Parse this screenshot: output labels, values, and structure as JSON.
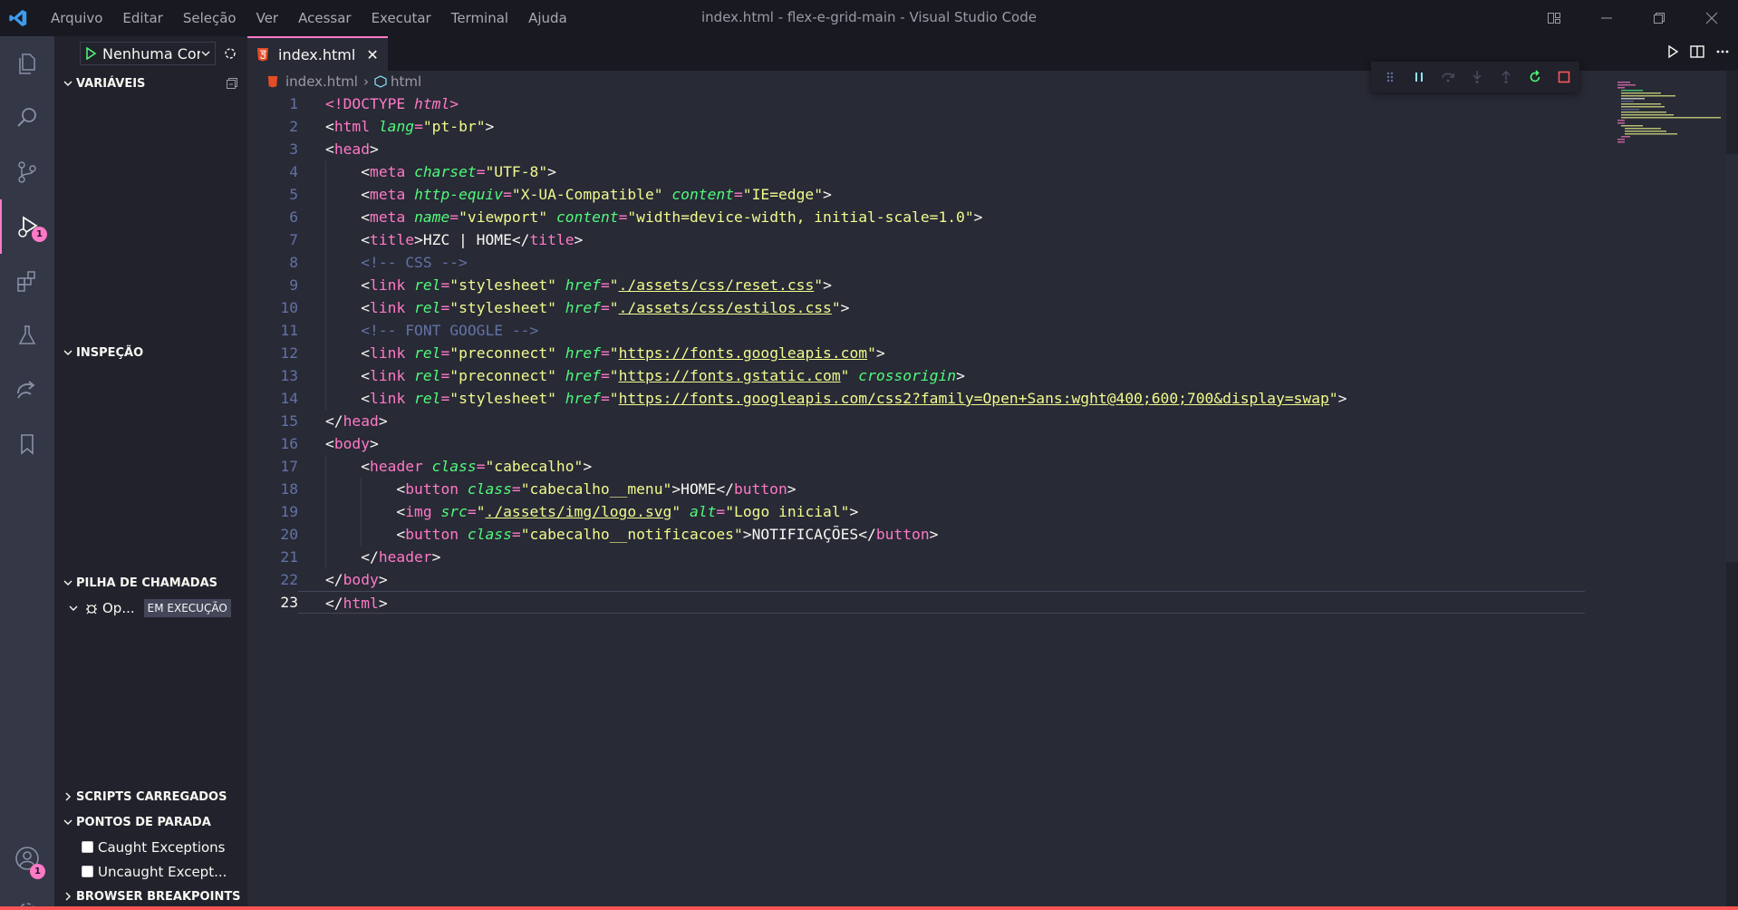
{
  "titlebar": {
    "menu": [
      "Arquivo",
      "Editar",
      "Seleção",
      "Ver",
      "Acessar",
      "Executar",
      "Terminal",
      "Ajuda"
    ],
    "window_title": "index.html - flex-e-grid-main - Visual Studio Code"
  },
  "activitybar": {
    "debug_badge": "1",
    "accounts_badge": "1"
  },
  "sidebar": {
    "run_config": "Nenhuma Cor",
    "variables_title": "VARIÁVEIS",
    "watch_title": "INSPEÇÃO",
    "callstack_title": "PILHA DE CHAMADAS",
    "callstack_item": "Op...",
    "callstack_status": "EM EXECUÇÃO",
    "loaded_scripts_title": "SCRIPTS CARREGADOS",
    "breakpoints_title": "PONTOS DE PARADA",
    "breakpoints": [
      "Caught Exceptions",
      "Uncaught Except..."
    ],
    "browser_breakpoints_title": "BROWSER BREAKPOINTS"
  },
  "editor": {
    "tab_label": "index.html",
    "breadcrumb": [
      "index.html",
      "html"
    ],
    "current_line": 23
  },
  "colors": {
    "accent": "#ff79c6",
    "background": "#282a36",
    "sidebar": "#21222c",
    "titlebar": "#191a21",
    "activitybar": "#343746"
  }
}
